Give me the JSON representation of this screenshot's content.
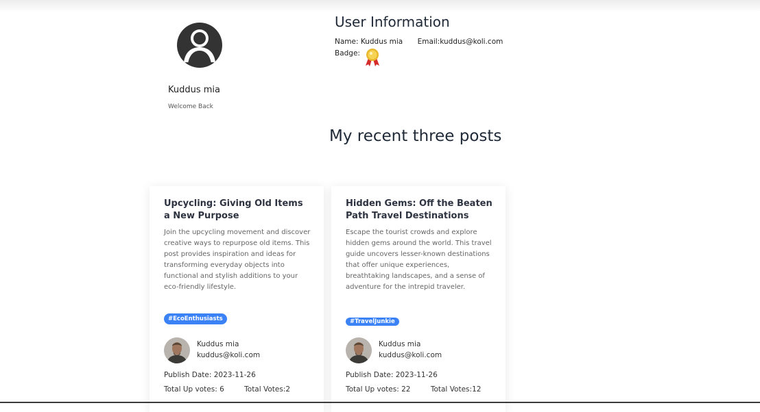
{
  "profile": {
    "name": "Kuddus mia",
    "welcome": "Welcome Back"
  },
  "user_info": {
    "title": "User Information",
    "name_label": "Name: Kuddus mia",
    "email_label": "Email:kuddus@koli.com",
    "badge_label": "Badge:",
    "badge_icon": "gold-medal-icon"
  },
  "posts_section": {
    "title": "My recent three posts"
  },
  "posts": [
    {
      "title": "Upcycling: Giving Old Items a New Purpose",
      "description": "Join the upcycling movement and discover creative ways to repurpose old items. This post provides inspiration and ideas for transforming everyday objects into functional and stylish additions to your eco-friendly lifestyle.",
      "tag": "#EcoEnthusiasts",
      "author_name": "Kuddus mia",
      "author_email": "kuddus@koli.com",
      "publish_date": "Publish Date: 2023-11-26",
      "up_votes": "Total Up votes: 6",
      "total_votes": "Total Votes:2"
    },
    {
      "title": "Hidden Gems: Off the Beaten Path Travel Destinations",
      "description": "Escape the tourist crowds and explore hidden gems around the world. This travel guide uncovers lesser-known destinations that offer unique experiences, breathtaking landscapes, and a sense of adventure for the intrepid traveler.",
      "tag": "#TravelJunkie",
      "author_name": "Kuddus mia",
      "author_email": "kuddus@koli.com",
      "publish_date": "Publish Date: 2023-11-26",
      "up_votes": "Total Up votes: 22",
      "total_votes": "Total Votes:12"
    }
  ],
  "colors": {
    "tag_background": "#3b82f6",
    "heading_text": "#1f2937",
    "body_text": "#666666"
  }
}
